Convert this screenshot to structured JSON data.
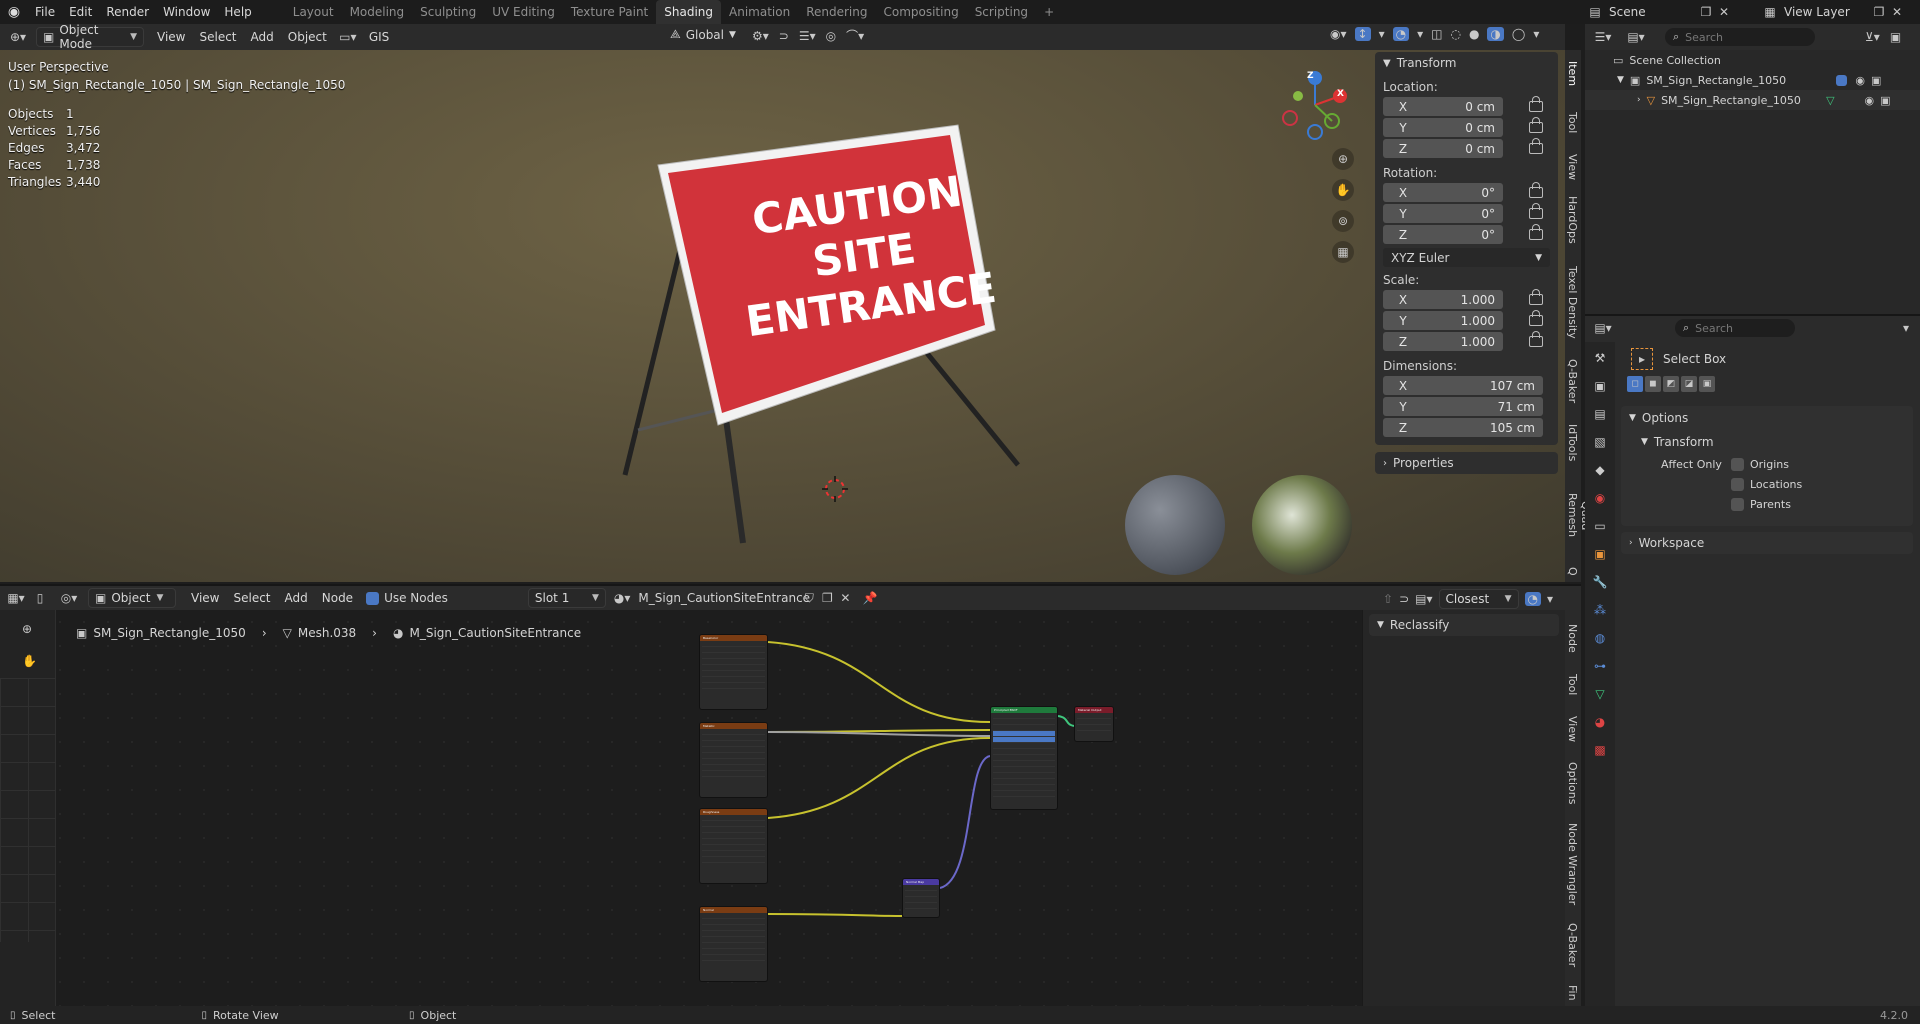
{
  "topbar": {
    "menus": [
      "File",
      "Edit",
      "Render",
      "Window",
      "Help"
    ],
    "workspaces": [
      "Layout",
      "Modeling",
      "Sculpting",
      "UV Editing",
      "Texture Paint",
      "Shading",
      "Animation",
      "Rendering",
      "Compositing",
      "Scripting"
    ],
    "active_workspace": "Shading",
    "add_tab": "+",
    "scene": "Scene",
    "view_layer": "View Layer"
  },
  "viewport_header": {
    "mode": "Object Mode",
    "menus": [
      "View",
      "Select",
      "Add",
      "Object",
      "GIS"
    ],
    "transform_orientation": "Global"
  },
  "viewport": {
    "perspective": "User Perspective",
    "object_line": "(1) SM_Sign_Rectangle_1050 | SM_Sign_Rectangle_1050",
    "stats": [
      {
        "k": "Objects",
        "v": "1"
      },
      {
        "k": "Vertices",
        "v": "1,756"
      },
      {
        "k": "Edges",
        "v": "3,472"
      },
      {
        "k": "Faces",
        "v": "1,738"
      },
      {
        "k": "Triangles",
        "v": "3,440"
      }
    ],
    "sign_text": [
      "CAUTION",
      "SITE",
      "ENTRANCE"
    ],
    "gizmo": {
      "x": "X",
      "y": "Y",
      "z": "Z"
    }
  },
  "npanel": {
    "transform_title": "Transform",
    "location_label": "Location:",
    "location": [
      {
        "a": "X",
        "v": "0 cm"
      },
      {
        "a": "Y",
        "v": "0 cm"
      },
      {
        "a": "Z",
        "v": "0 cm"
      }
    ],
    "rotation_label": "Rotation:",
    "rotation": [
      {
        "a": "X",
        "v": "0°"
      },
      {
        "a": "Y",
        "v": "0°"
      },
      {
        "a": "Z",
        "v": "0°"
      }
    ],
    "rotation_mode": "XYZ Euler",
    "scale_label": "Scale:",
    "scale": [
      {
        "a": "X",
        "v": "1.000"
      },
      {
        "a": "Y",
        "v": "1.000"
      },
      {
        "a": "Z",
        "v": "1.000"
      }
    ],
    "dimensions_label": "Dimensions:",
    "dimensions": [
      {
        "a": "X",
        "v": "107 cm"
      },
      {
        "a": "Y",
        "v": "71 cm"
      },
      {
        "a": "Z",
        "v": "105 cm"
      }
    ],
    "properties_title": "Properties",
    "tabs": [
      "Item",
      "Tool",
      "View",
      "HardOps",
      "Texel Density",
      "Q-Baker",
      "IdTools",
      "Quad Remesh",
      "Q"
    ]
  },
  "outliner": {
    "search_placeholder": "Search",
    "collection": "Scene Collection",
    "items": [
      "SM_Sign_Rectangle_1050",
      "SM_Sign_Rectangle_1050"
    ]
  },
  "properties": {
    "search_placeholder": "Search",
    "tool": "Select Box",
    "options": "Options",
    "transform": "Transform",
    "affect_only": "Affect Only",
    "checks": [
      "Origins",
      "Locations",
      "Parents"
    ],
    "workspace": "Workspace"
  },
  "node_header": {
    "type": "Object",
    "menus": [
      "View",
      "Select",
      "Add",
      "Node"
    ],
    "use_nodes": "Use Nodes",
    "slot": "Slot 1",
    "material": "M_Sign_CautionSiteEntrance",
    "snap": "Closest"
  },
  "breadcrumb": {
    "object": "SM_Sign_Rectangle_1050",
    "mesh": "Mesh.038",
    "material": "M_Sign_CautionSiteEntrance"
  },
  "node_sidebar": {
    "title": "Reclassify",
    "tabs": [
      "Node",
      "Tool",
      "View",
      "Options",
      "Node Wrangler",
      "Q-Baker",
      "Fin"
    ]
  },
  "nodes": [
    {
      "title": "BaseColor"
    },
    {
      "title": "Metallic"
    },
    {
      "title": "Roughness"
    },
    {
      "title": "Normal"
    },
    {
      "title": "Principled BSDF"
    },
    {
      "title": "Material Output"
    },
    {
      "title": "Normal Map"
    }
  ],
  "statusbar": {
    "select": "Select",
    "rotate": "Rotate View",
    "object": "Object",
    "version": "4.2.0"
  },
  "colors": {
    "accent": "#4a78c4",
    "sign_red": "#d1333a",
    "header_orange": "#7a3c13"
  }
}
